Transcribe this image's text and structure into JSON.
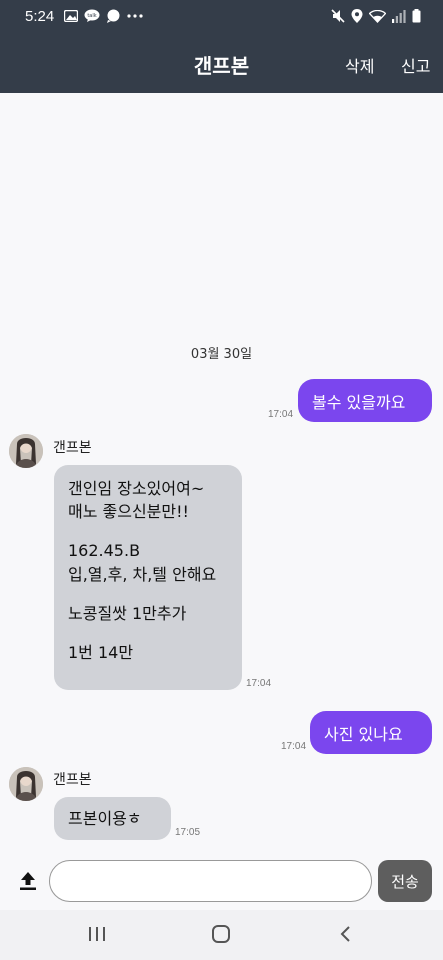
{
  "status_bar": {
    "time": "5:24",
    "left_icons": [
      "gallery-icon",
      "talk-icon",
      "chat-bubble-icon",
      "more-dots-icon"
    ],
    "right_icons": [
      "mute-icon",
      "location-icon",
      "wifi-icon",
      "signal-icon",
      "battery-icon"
    ]
  },
  "header": {
    "title": "갠프본",
    "delete_label": "삭제",
    "report_label": "신고"
  },
  "chat": {
    "date_separator": "03월 30일",
    "messages": [
      {
        "direction": "out",
        "text": "볼수 있을까요",
        "time": "17:04"
      },
      {
        "direction": "in",
        "sender": "갠프본",
        "lines": [
          "갠인임 장소있어여~",
          "매노 좋으신분만!!",
          "",
          "162.45.B",
          "입,열,후, 차,텔 안해요",
          "",
          "노콩질쌋 1만추가",
          "",
          "1번 14만"
        ],
        "time": "17:04"
      },
      {
        "direction": "out",
        "text": "사진 있나요",
        "time": "17:04"
      },
      {
        "direction": "in",
        "sender": "갠프본",
        "lines": [
          "프본이용ㅎ"
        ],
        "time": "17:05"
      }
    ]
  },
  "input_bar": {
    "placeholder": "",
    "value": "",
    "send_label": "전송",
    "upload_icon": "upload-icon"
  },
  "nav_bar": {
    "icons": [
      "recents-icon",
      "home-icon",
      "back-icon"
    ]
  },
  "colors": {
    "header_bg": "#343d49",
    "outgoing_bubble": "#7b46ee",
    "incoming_bubble": "#d0d2d7",
    "send_button": "#5e5e5e"
  }
}
